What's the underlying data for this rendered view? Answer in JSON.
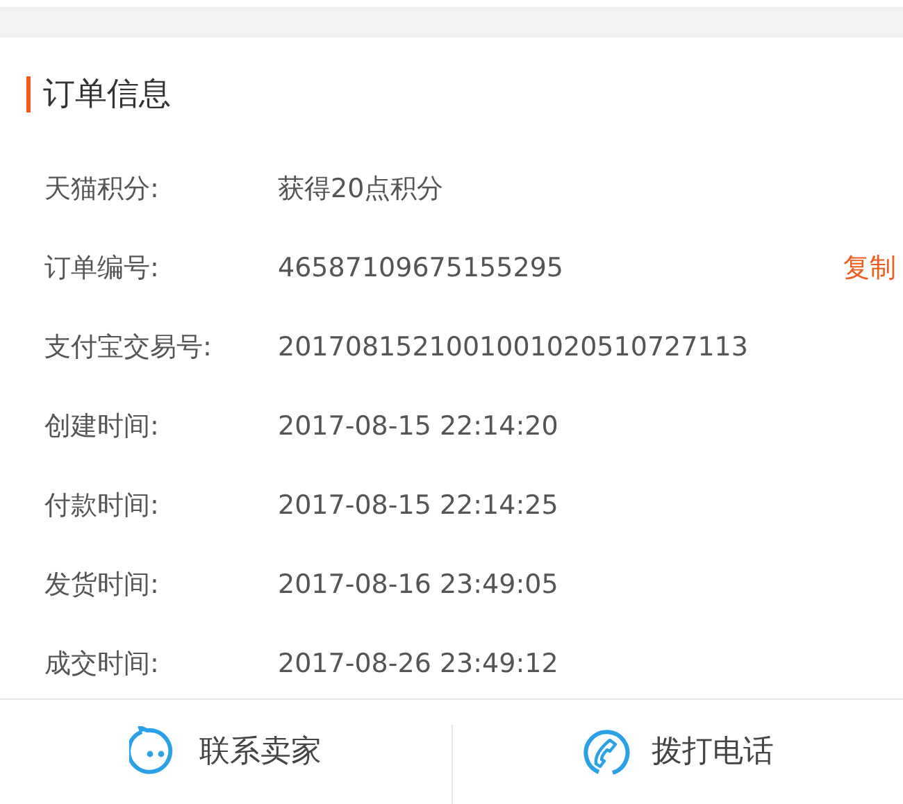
{
  "section": {
    "title": "订单信息"
  },
  "rows": [
    {
      "label": "天猫积分:",
      "value": "获得20点积分"
    },
    {
      "label": "订单编号:",
      "value": "46587109675155295",
      "action": "复制"
    },
    {
      "label": "支付宝交易号:",
      "value": "2017081521001001020510727113"
    },
    {
      "label": "创建时间:",
      "value": "2017-08-15 22:14:20"
    },
    {
      "label": "付款时间:",
      "value": "2017-08-15 22:14:25"
    },
    {
      "label": "发货时间:",
      "value": "2017-08-16 23:49:05"
    },
    {
      "label": "成交时间:",
      "value": "2017-08-26 23:49:12"
    }
  ],
  "footer": [
    {
      "kind": "chat",
      "label": "联系卖家"
    },
    {
      "kind": "phone",
      "label": "拨打电话"
    }
  ]
}
